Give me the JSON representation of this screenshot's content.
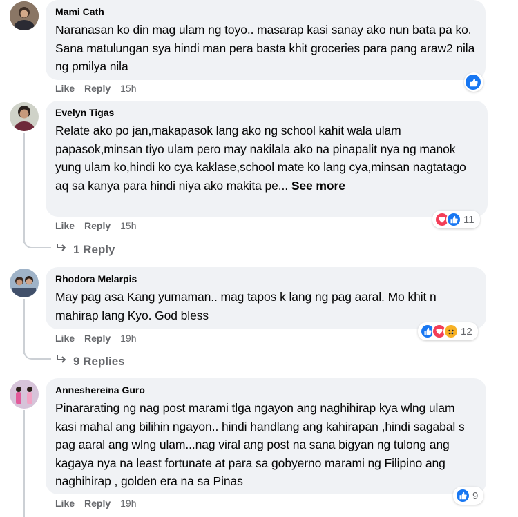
{
  "comments": [
    {
      "author": "Mami Cath",
      "text": "Naranasan ko din mag ulam ng toyo.. masarap kasi sanay ako nun bata pa ko. Sana matulungan sya hindi man pera basta khit groceries para pang araw2 nila ng pmilya nila",
      "see_more": "",
      "like": "Like",
      "reply": "Reply",
      "time": "15h",
      "reaction_count": ""
    },
    {
      "author": "Evelyn Tigas",
      "text": "Relate ako po jan,makapasok lang ako ng school kahit wala ulam papasok,minsan tiyo ulam pero may nakilala ako na pinapalit nya ng manok yung ulam ko,hindi ko cya kaklase,school mate ko lang cya,minsan nagtatago aq sa kanya para hindi niya ako makita pe...",
      "see_more": "See more",
      "like": "Like",
      "reply": "Reply",
      "time": "15h",
      "reaction_count": "11",
      "replies": "1 Reply"
    },
    {
      "author": "Rhodora Melarpis",
      "text": "May pag asa Kang yumaman.. mag tapos k lang ng pag aaral. Mo khit n mahirap lang Kyo. God bless",
      "see_more": "",
      "like": "Like",
      "reply": "Reply",
      "time": "19h",
      "reaction_count": "12",
      "replies": "9 Replies"
    },
    {
      "author": "Anneshereina Guro",
      "text": "Pinararating ng nag post marami tlga ngayon ang naghihirap kya wlng ulam kasi mahal ang bilihin ngayon.. hindi handlang ang kahirapan ,hindi sagabal s pag aaral ang wlng ulam...nag viral ang post na sana bigyan ng tulong ang kagaya nya na least fortunate at para sa gobyerno marami ng Filipino ang naghihirap , golden era na sa Pinas",
      "see_more": "",
      "like": "Like",
      "reply": "Reply",
      "time": "19h",
      "reaction_count": "9"
    }
  ],
  "colors": {
    "bubble": "#f0f2f5",
    "like_blue": "#1877f2",
    "love_red": "#f33e58",
    "haha_yellow": "#f7b125",
    "meta_gray": "#65676b"
  }
}
